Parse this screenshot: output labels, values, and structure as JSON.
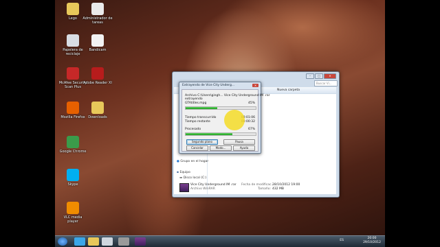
{
  "desktop_icons": [
    {
      "label": "Lego",
      "color": "#e8c85a",
      "icon": "folder-icon"
    },
    {
      "label": "Administrador de tareas",
      "color": "#eaeaea",
      "icon": "document-icon"
    },
    {
      "label": "Papelera de reciclaje",
      "color": "#d8dde3",
      "icon": "recycle-bin-icon"
    },
    {
      "label": "Bandicam",
      "color": "#f2f2f2",
      "icon": "app-icon"
    },
    {
      "label": "McAfee Security Scan Plus",
      "color": "#c62828",
      "icon": "shield-icon"
    },
    {
      "label": "Adobe Reader XI",
      "color": "#b71c1c",
      "icon": "pdf-icon"
    },
    {
      "label": "Mozilla Firefox",
      "color": "#e66000",
      "icon": "firefox-icon"
    },
    {
      "label": "Downloads",
      "color": "#e8c85a",
      "icon": "folder-icon"
    },
    {
      "label": "Google Chrome",
      "color": "#3a9b4a",
      "icon": "chrome-icon"
    },
    {
      "label": "Skype",
      "color": "#00aff0",
      "icon": "skype-icon"
    },
    {
      "label": "VLC media player",
      "color": "#f08c00",
      "icon": "vlc-icon"
    }
  ],
  "explorer": {
    "toolbar_new_folder": "Nueva carpeta",
    "search_placeholder": "Buscar Vi...",
    "nav": {
      "home_group": "Grupo en el hogar",
      "computer": "Equipo",
      "local_disk": "Disco local (C:)"
    },
    "file": {
      "name": "Vice City Underground IM .rar",
      "type": "Archivo WinRAR",
      "modified_label": "Fecha de modificac...",
      "modified_value": "28/10/2012 19:00",
      "size_label": "Tamaño:",
      "size_value": "432 MB"
    }
  },
  "dialog": {
    "title": "Extrayendo de Vice City Underg...",
    "archive_line": "Archivo C:\\Users\\gingh... Vice City Underground IM .rar",
    "status": "extrayendo",
    "current_file": "GTAtitles.mpg",
    "file_percent": "45%",
    "file_progress": 0.45,
    "elapsed_label": "Tiempo transcurrido",
    "elapsed_value": "00:01:06",
    "remaining_label": "Tiempo restante",
    "remaining_value": "00:00:32",
    "processed_label": "Procesado",
    "processed_percent": "67%",
    "processed_progress": 0.67,
    "buttons": {
      "background": "Segundo plano",
      "pause": "Pausa",
      "cancel": "Cancelar",
      "mode": "Modo...",
      "help": "Ayuda"
    }
  },
  "taskbar": {
    "lang": "ES",
    "time": "20:00",
    "date": "29/10/2012"
  }
}
